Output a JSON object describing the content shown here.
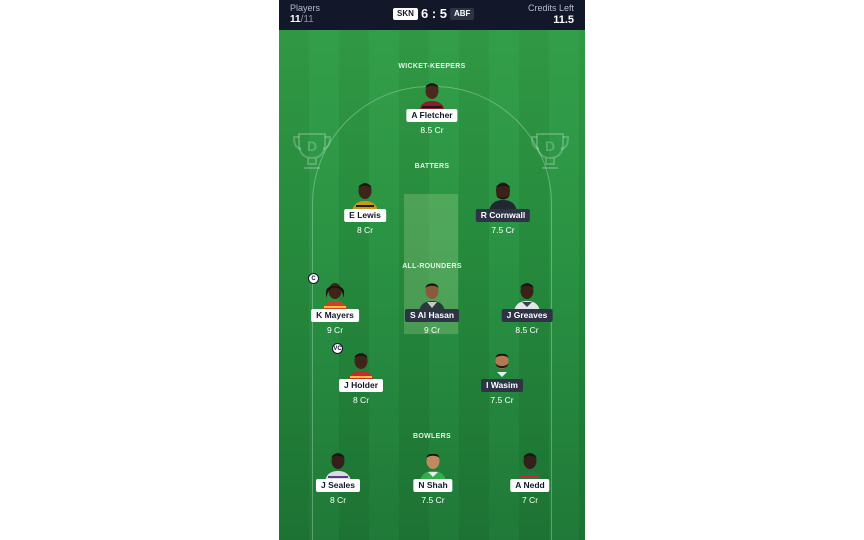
{
  "header": {
    "players_label": "Players",
    "players_count": "11",
    "players_max": "/11",
    "team_a": "SKN",
    "score": "6 : 5",
    "team_b": "ABF",
    "credits_label": "Credits Left",
    "credits_value": "11.5"
  },
  "sections": {
    "wicket_keepers": "WICKET-KEEPERS",
    "batters": "BATTERS",
    "all_rounders": "ALL-ROUNDERS",
    "bowlers": "BOWLERS"
  },
  "players": {
    "fletcher": {
      "name": "A Fletcher",
      "credit": "8.5 Cr",
      "team": "SKN"
    },
    "lewis": {
      "name": "E Lewis",
      "credit": "8 Cr",
      "team": "SKN"
    },
    "cornwall": {
      "name": "R Cornwall",
      "credit": "7.5 Cr",
      "team": "ABF"
    },
    "mayers": {
      "name": "K Mayers",
      "credit": "9 Cr",
      "team": "SKN",
      "role": "C"
    },
    "alhasan": {
      "name": "S Al Hasan",
      "credit": "9 Cr",
      "team": "ABF"
    },
    "greaves": {
      "name": "J Greaves",
      "credit": "8.5 Cr",
      "team": "ABF"
    },
    "holder": {
      "name": "J Holder",
      "credit": "8 Cr",
      "team": "SKN",
      "role": "VC"
    },
    "wasim": {
      "name": "I Wasim",
      "credit": "7.5 Cr",
      "team": "ABF"
    },
    "sealles": {
      "name": "J Seales",
      "credit": "8 Cr",
      "team": "SKN"
    },
    "shah": {
      "name": "N Shah",
      "credit": "7.5 Cr",
      "team": "SKN"
    },
    "nedd": {
      "name": "A Nedd",
      "credit": "7 Cr",
      "team": "SKN"
    }
  },
  "colors": {
    "header_bg": "#13172a",
    "field_green": "#268b3d",
    "tag_team_a": "#ffffff",
    "tag_team_b": "#2e3346"
  },
  "icons": {
    "watermark": "trophy-d-logo-icon",
    "avatar": "player-avatar-icon"
  }
}
